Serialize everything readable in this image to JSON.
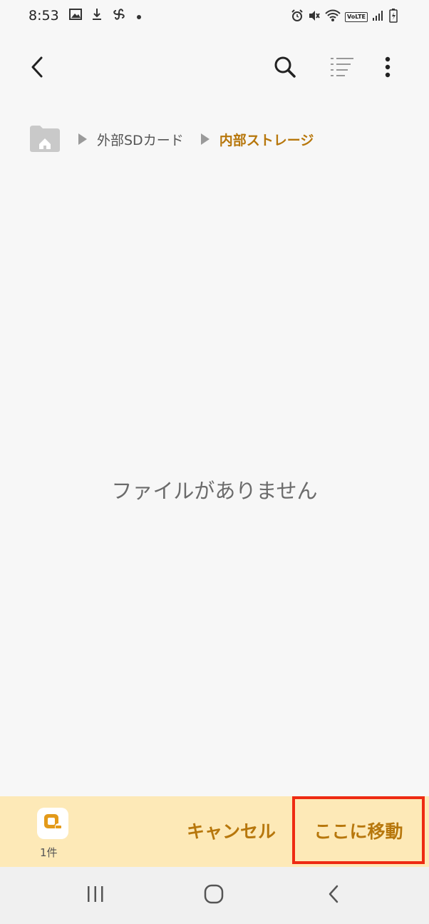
{
  "status_bar": {
    "time": "8:53",
    "left_icons": [
      "gallery-icon",
      "download-icon",
      "pinwheel-icon",
      "dot-icon"
    ],
    "right_icons": [
      "alarm-icon",
      "mute-icon",
      "wifi-icon",
      "volte-icon",
      "signal-icon",
      "battery-icon"
    ],
    "volte_label": "VoLTE"
  },
  "toolbar": {
    "back_icon": "chevron-left-icon",
    "search_icon": "search-icon",
    "list_icon": "list-view-icon",
    "more_icon": "more-vertical-icon"
  },
  "breadcrumb": {
    "home_icon": "home-folder-icon",
    "items": [
      "外部SDカード",
      "内部ストレージ"
    ]
  },
  "main": {
    "empty_message": "ファイルがありません"
  },
  "bottom_bar": {
    "selected_count": "1件",
    "cancel_label": "キャンセル",
    "move_label": "ここに移動"
  },
  "nav_bar": {
    "recent_icon": "recent-apps-icon",
    "home_icon": "home-circle-icon",
    "back_icon": "back-chevron-icon"
  },
  "colors": {
    "accent": "#b7770c",
    "bottom_bar_bg": "#fde9b7",
    "highlight_border": "#ee2b12",
    "background": "#f7f7f7"
  }
}
